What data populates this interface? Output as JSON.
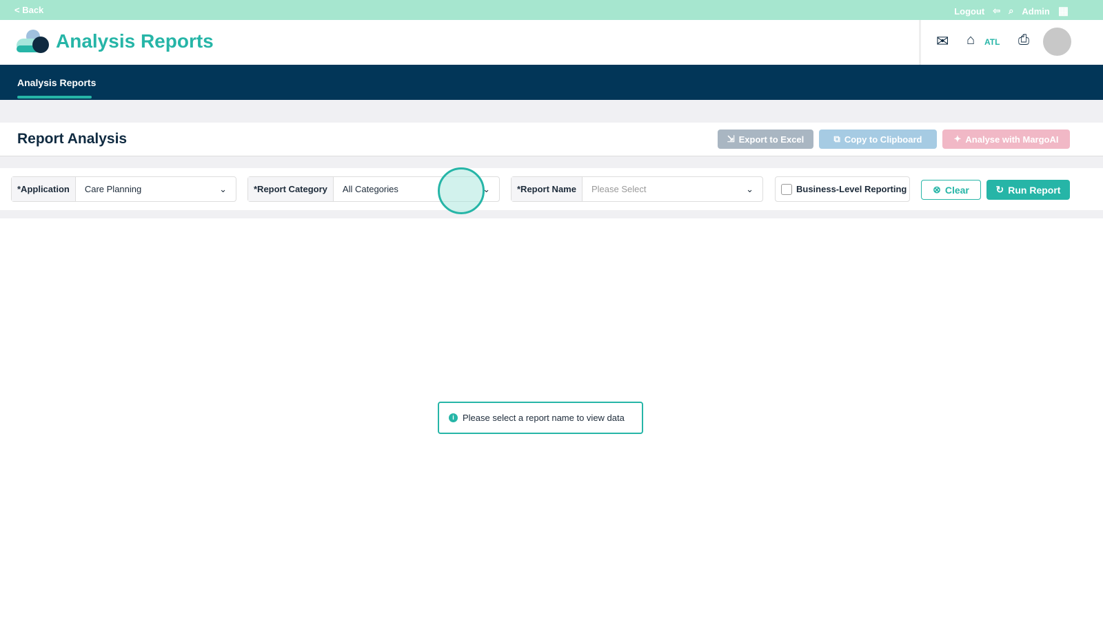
{
  "topbar": {
    "back": "< Back",
    "logout": "Logout",
    "user": "Admin"
  },
  "header": {
    "title": "Analysis Reports",
    "home_label": "ATL"
  },
  "nav": {
    "tabs": [
      {
        "label": "Analysis Reports"
      }
    ]
  },
  "page": {
    "title": "Report Analysis",
    "export": "Export to Excel",
    "copy": "Copy to Clipboard",
    "analyse": "Analyse with MargoAI"
  },
  "filters": {
    "application": {
      "label": "*Application",
      "value": "Care Planning"
    },
    "category": {
      "label": "*Report Category",
      "value": "All Categories"
    },
    "report": {
      "label": "*Report Name",
      "placeholder": "Please Select"
    },
    "business": "Business-Level Reporting",
    "clear": "Clear",
    "run": "Run Report"
  },
  "message": "Please select a report name to view data",
  "colors": {
    "accent": "#26b5a7",
    "nav": "#023658",
    "topbar": "#a6e6cf"
  }
}
